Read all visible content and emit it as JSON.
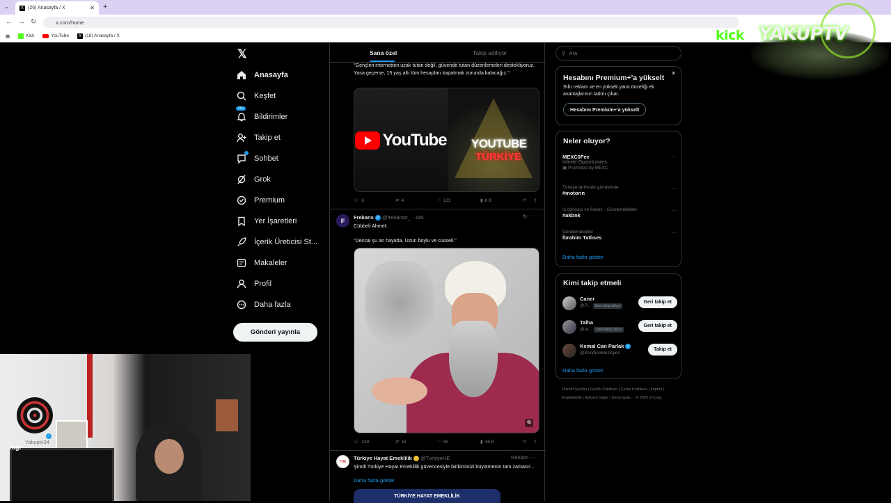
{
  "browser": {
    "tab_title": "(26) Anasayfa / X",
    "url": "x.com/home",
    "bookmarks": [
      "Kick",
      "YouTube",
      "(18) Anasayfa / X"
    ]
  },
  "nav": {
    "items": [
      {
        "label": "Anasayfa"
      },
      {
        "label": "Keşfet"
      },
      {
        "label": "Bildirimler",
        "badge": "20+"
      },
      {
        "label": "Takip et"
      },
      {
        "label": "Sohbet"
      },
      {
        "label": "Grok"
      },
      {
        "label": "Premium"
      },
      {
        "label": "Yer İşaretleri"
      },
      {
        "label": "İçerik Üreticisi St..."
      },
      {
        "label": "Makaleler"
      },
      {
        "label": "Profil"
      },
      {
        "label": "Daha fazla"
      }
    ],
    "post_button": "Gönderi yayınla",
    "account_name": "akupTV",
    "account_handle": "Yakuptv34"
  },
  "feed": {
    "tabs": [
      "Sana özel",
      "Takip ediliyor"
    ],
    "tweets": [
      {
        "text": "\"Gençleri internetten uzak tutan değil, güvende tutan düzenlemeleri destekliyoruz. Yasa geçerse, 15 yaş altı tüm hesapları kapatmak zorunda kalacağız.\"",
        "media_left": "YouTube",
        "media_right_1": "YOUTUBE",
        "media_right_2": "TÜRKİYE",
        "replies": "8",
        "reposts": "4",
        "likes": "123",
        "views": "6 B"
      },
      {
        "name": "Frekans",
        "handle": "@frekanstr_ · 18s",
        "line1": "Cübbeli Ahmet:",
        "line2": "\"Deccal şu an hayatta. Uzun boylu ve cüsseli.\"",
        "replies": "239",
        "reposts": "44",
        "likes": "89",
        "views": "36 B"
      },
      {
        "name": "Türkiye Hayat Emeklilik",
        "handle": "@TurkiyeHE",
        "ad_label": "Reklam",
        "text": "Şimdi Türkiye Hayat Emeklilik güvencesiyle birikiminizi büyütmenin tam zamanı!...",
        "show_more": "Daha fazla göster",
        "banner": "TÜRKİYE HAYAT EMEKLİLİK"
      }
    ]
  },
  "right": {
    "search_placeholder": "Ara",
    "premium": {
      "title": "Hesabını Premium+'a yükselt",
      "desc": "Sıfır reklam ve en yüksek yanıt önceliği ek avantajlarının tadını çıkar.",
      "button": "Hesabını Premium+'a yükselt"
    },
    "trends": {
      "title": "Neler oluyor?",
      "items": [
        {
          "l1": "MEXC0Fee",
          "l2": "Infinite Opportunities",
          "l3": "Promoted by MEXC"
        },
        {
          "l1": "Türkiye tarihinde gündemde",
          "l2": "#motorin"
        },
        {
          "l1": "İş dünyası ve finans · Gündemdekiler",
          "l2": "#akbnk"
        },
        {
          "l1": "Gündemdekiler",
          "l2": "İbrahim Tatlıses"
        }
      ],
      "show_more": "Daha fazla göster"
    },
    "who_to_follow": {
      "title": "Kimi takip etmeli",
      "items": [
        {
          "name": "Caner",
          "handle": "@P...",
          "tag": "Seni takip ediyor",
          "button": "Geri takip et"
        },
        {
          "name": "Talha",
          "handle": "@ta...",
          "tag": "Seni takip ediyor",
          "button": "Geri takip et"
        },
        {
          "name": "Kemal Can Parlak",
          "handle": "@KendineMuzisyen",
          "tag": "",
          "button": "Takip et"
        }
      ],
      "show_more": "Daha fazla göster"
    },
    "footer": "Hizmet Şartları  |  Gizlilik Politikası  |  Çerez Politikası  |  Imprint  |  Erişilebilirlik  |  Reklam bilgisi  |  Daha fazla ···  © 2026 X Corp."
  },
  "overlay": {
    "kick": "kick",
    "brand": "YAKUPTV"
  },
  "colors": {
    "accent": "#1d9bf0",
    "kick_green": "#53fc18"
  }
}
